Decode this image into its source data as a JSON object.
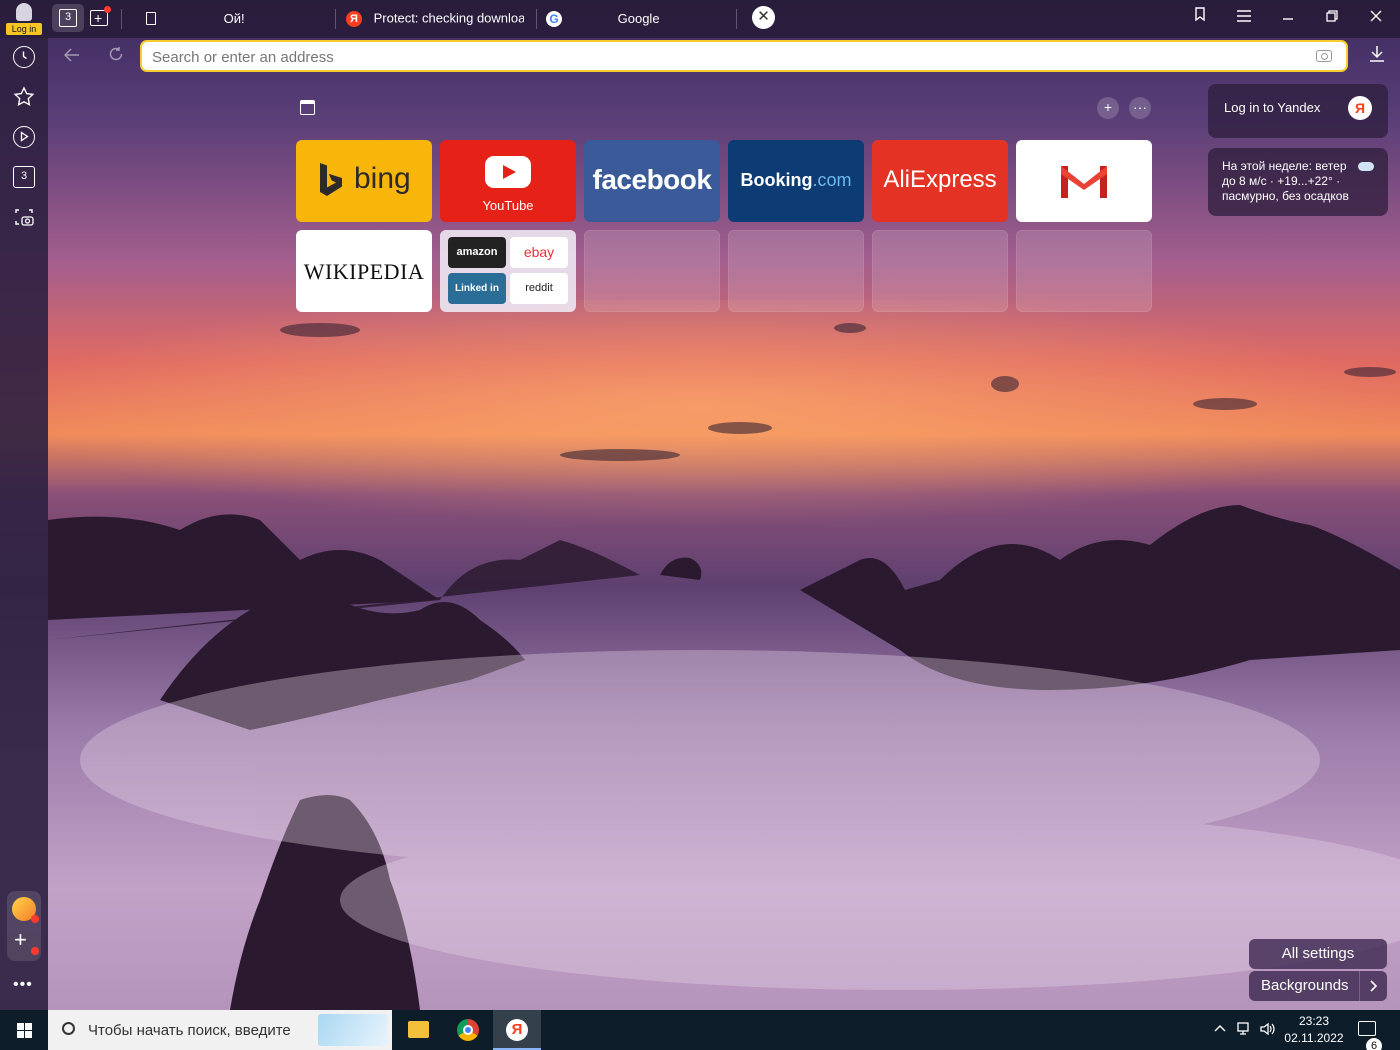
{
  "tabbar": {
    "login_label": "Log in",
    "tab_count": "3",
    "tabs": [
      {
        "title": "Ой!",
        "icon": "page-icon"
      },
      {
        "title": "Protect: checking downloa",
        "icon": "yandex-icon"
      },
      {
        "title": "Google",
        "icon": "google-icon"
      }
    ],
    "close_glyph": "✕",
    "window_buttons": [
      "bookmarks-collection-icon",
      "menu-icon",
      "minimize-icon",
      "restore-icon",
      "close-icon"
    ]
  },
  "sidebar": {
    "tab_count": "3",
    "items": [
      "history-icon",
      "bookmark-star-icon",
      "video-play-icon",
      "tabs-count-icon",
      "screenshot-icon"
    ],
    "more_glyph": "•••"
  },
  "addressbar": {
    "placeholder": "Search or enter an address"
  },
  "speed_dial": {
    "tiles": [
      {
        "name": "bing",
        "label": "bing"
      },
      {
        "name": "youtube",
        "label": "YouTube"
      },
      {
        "name": "facebook",
        "label": "facebook"
      },
      {
        "name": "booking",
        "label": "Booking",
        "suffix": ".com"
      },
      {
        "name": "aliexpress",
        "label": "AliExpress"
      },
      {
        "name": "gmail",
        "label": ""
      },
      {
        "name": "wikipedia",
        "label": "WIKIPEDIA"
      }
    ],
    "folder": {
      "items": [
        "amazon",
        "ebay",
        "Linked in",
        "reddit"
      ]
    },
    "add_glyph": "+",
    "more_glyph": "···"
  },
  "widgets": {
    "login_text": "Log in to Yandex",
    "ya_letter": "Я",
    "weather_text": "На этой неделе: ветер до 8 м/с · +19...+22° · пасмурно, без осадков"
  },
  "buttons": {
    "all_settings": "All settings",
    "backgrounds": "Backgrounds"
  },
  "taskbar": {
    "search_placeholder": "Чтобы начать поиск, введите",
    "time": "23:23",
    "date": "02.11.2022",
    "notification_count": "6"
  },
  "colors": {
    "address_border": "#f8cd2b",
    "yandex_red": "#fc3f1d"
  }
}
